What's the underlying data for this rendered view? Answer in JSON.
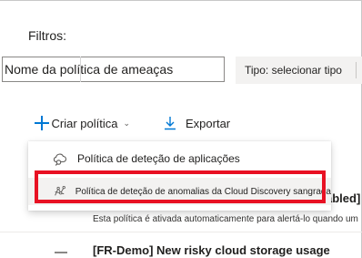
{
  "filters": {
    "label": "Filtros:",
    "search_value": "Nome da política de ameaças",
    "type_filter": "Tipo: selecionar tipo"
  },
  "toolbar": {
    "create_label": "Criar política",
    "create_chevron": "⌄",
    "export_label": "Exportar"
  },
  "dropdown": {
    "items": [
      {
        "label": "Política de deteção de aplicações",
        "icon": "cloud-search-icon"
      },
      {
        "label": "Política de deteção de anomalias da Cloud Discovery sangrada",
        "icon": "anomaly-icon"
      }
    ]
  },
  "background_list": {
    "row1_title_fragment": "abled]",
    "row1_desc": "Esta política é ativada automaticamente para alertá-lo quando um",
    "row2_title": "[FR-Demo] New risky cloud storage usage"
  },
  "colors": {
    "accent": "#0078d4",
    "highlight": "#e81123",
    "hover": "#f3f2f1"
  }
}
